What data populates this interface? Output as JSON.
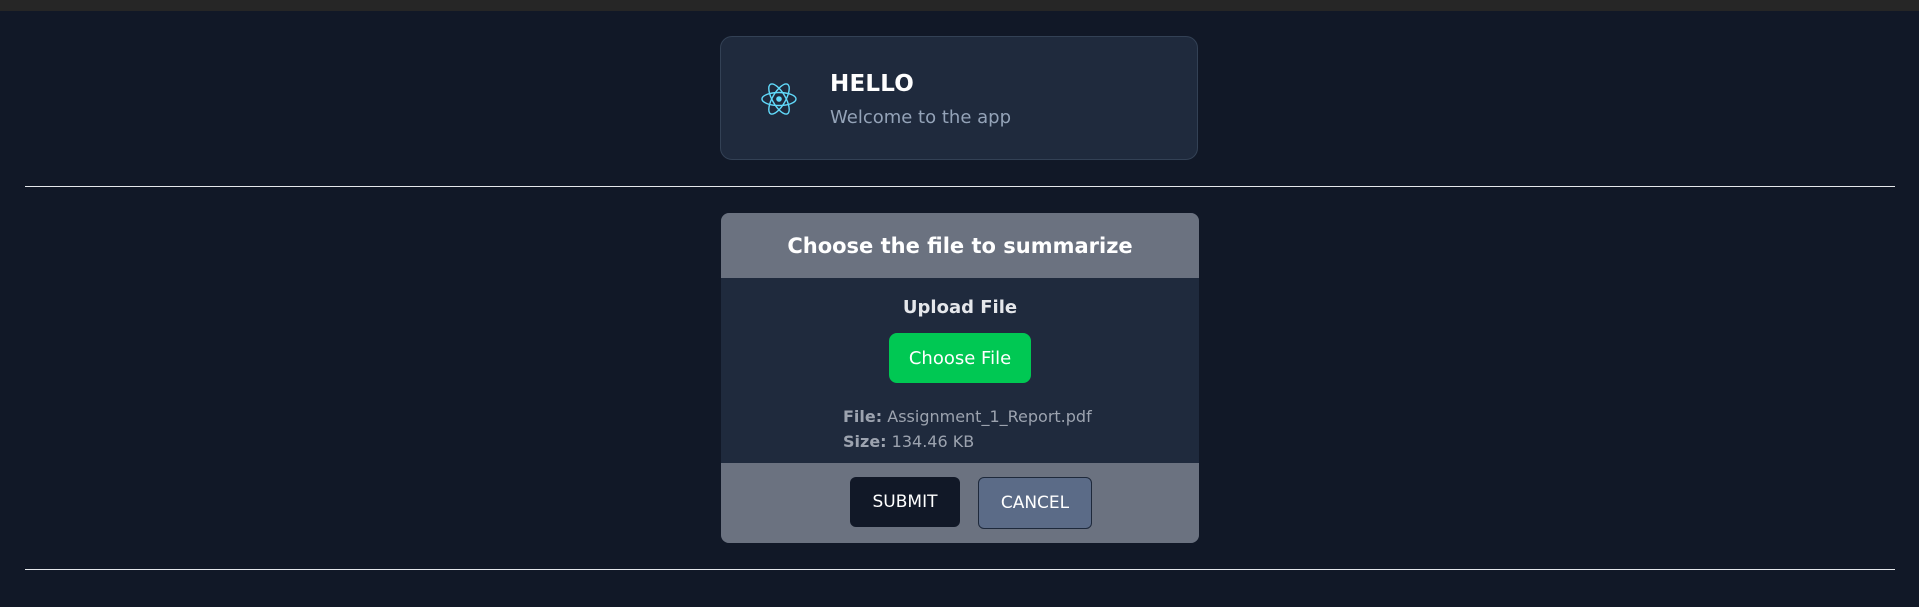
{
  "header": {
    "title": "HELLO",
    "subtitle": "Welcome to the app",
    "icon": "react-atom-icon",
    "icon_color": "#61dafb"
  },
  "upload": {
    "heading": "Choose the file to summarize",
    "label": "Upload File",
    "choose_button": "Choose File",
    "file_key": "File:",
    "file_name": "Assignment_1_Report.pdf",
    "size_key": "Size:",
    "file_size": "134.46 KB",
    "submit_button": "SUBMIT",
    "cancel_button": "CANCEL"
  },
  "colors": {
    "background": "#111827",
    "card": "#1f2a3d",
    "panel": "#6b7280",
    "choose_button": "#00c853",
    "submit_button": "#111827",
    "cancel_button": "#5b6b87"
  }
}
